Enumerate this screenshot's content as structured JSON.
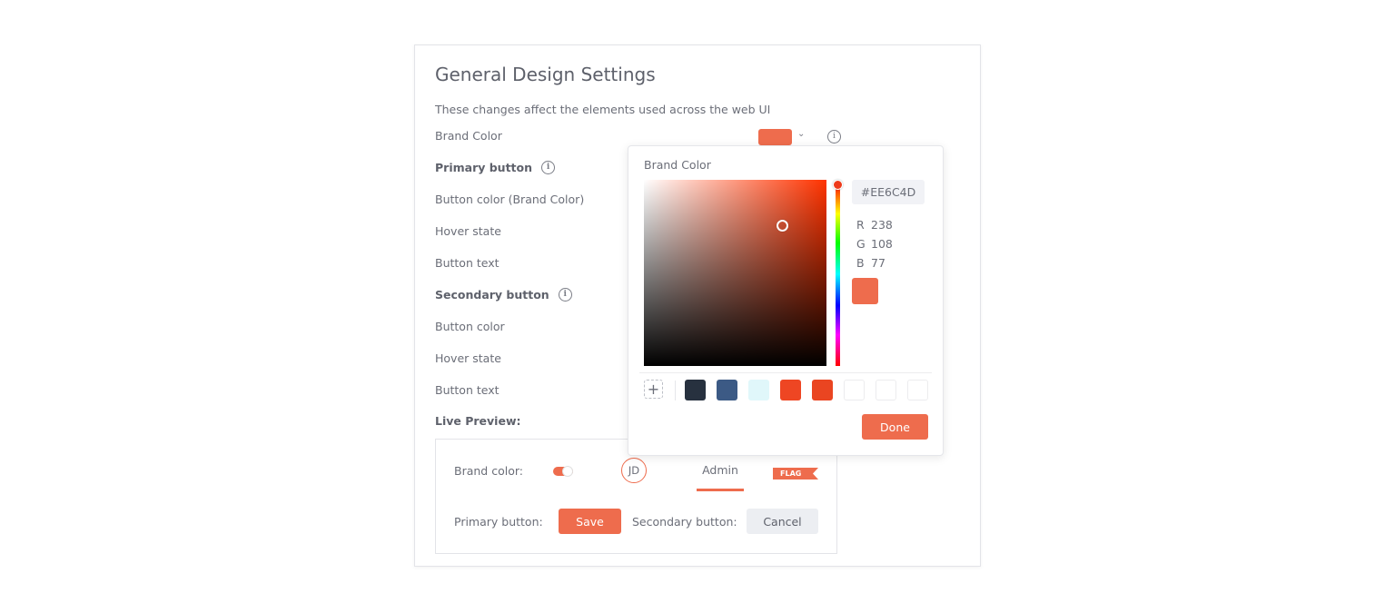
{
  "settings": {
    "title": "General Design Settings",
    "subtitle": "These changes affect the elements used across the web UI",
    "brand_color_label": "Brand Color",
    "brand_color_value": "#EE6C4D",
    "primary_button": {
      "heading": "Primary button",
      "rows": [
        "Button color (Brand Color)",
        "Hover state",
        "Button text"
      ]
    },
    "secondary_button": {
      "heading": "Secondary button",
      "rows": [
        "Button color",
        "Hover state",
        "Button text"
      ]
    },
    "live_preview_label": "Live Preview:"
  },
  "preview": {
    "brand_color_label": "Brand color:",
    "toggle_on": true,
    "avatar_initials": "JD",
    "tab_label": "Admin",
    "flag_label": "FLAG",
    "primary_button_label": "Primary button:",
    "save_label": "Save",
    "secondary_button_label": "Secondary button:",
    "cancel_label": "Cancel"
  },
  "color_picker": {
    "title": "Brand Color",
    "hex": "#EE6C4D",
    "rgb": [
      {
        "key": "R",
        "value": "238"
      },
      {
        "key": "G",
        "value": "108"
      },
      {
        "key": "B",
        "value": "77"
      }
    ],
    "add_symbol": "+",
    "swatches": [
      "#27313f",
      "#3c5a85",
      "#e0f7fa",
      "#ee4623",
      "#ea4521",
      "#ffffff",
      "#ffffff",
      "#ffffff"
    ],
    "done_label": "Done"
  },
  "icons": {
    "info": "i",
    "chevron": "⌄"
  },
  "colors": {
    "accent": "#EE6C4D"
  }
}
